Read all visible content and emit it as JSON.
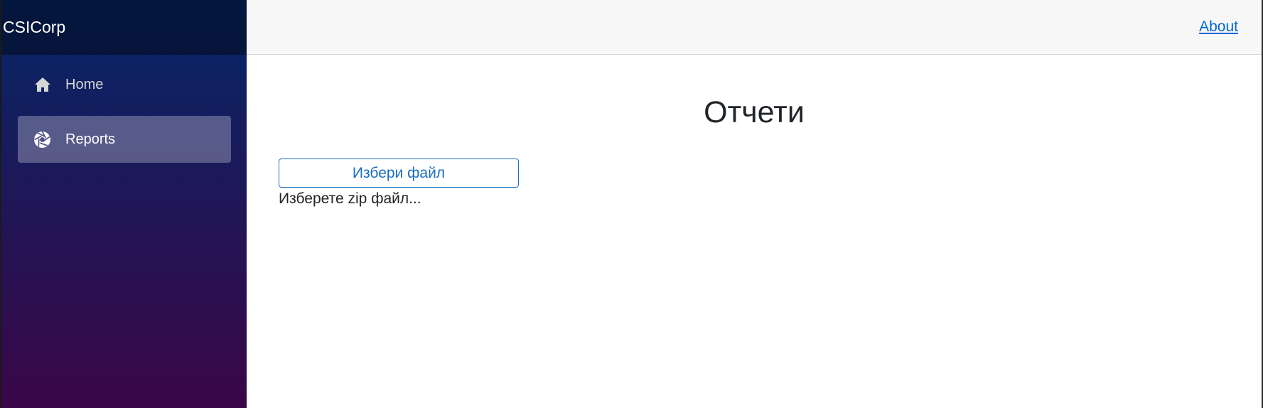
{
  "app": {
    "brand": "CSICorp"
  },
  "sidebar": {
    "items": [
      {
        "label": "Home",
        "icon": "home-icon",
        "active": false
      },
      {
        "label": "Reports",
        "icon": "aperture-icon",
        "active": true
      }
    ]
  },
  "topbar": {
    "about_label": "About"
  },
  "main": {
    "title": "Отчети",
    "file_button_label": "Избери файл",
    "hint": "Изберете zip файл..."
  },
  "colors": {
    "sidebar_top": "#052767",
    "sidebar_bottom": "#3a0647",
    "accent": "#1b6ec2",
    "link": "#0366d6"
  }
}
